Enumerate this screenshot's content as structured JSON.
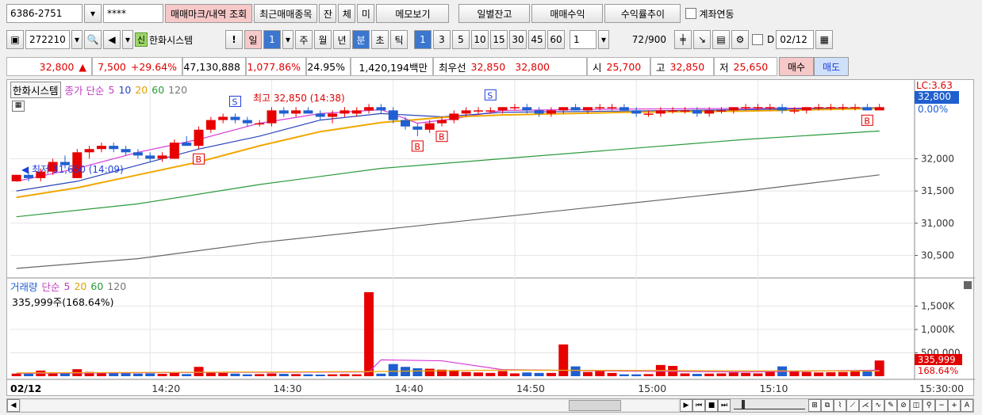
{
  "toolbar": {
    "account": "6386-2751",
    "password": "****",
    "btn_mark": "매매마크/내역 조회",
    "btn_recent": "최근매매종목",
    "btn_jan": "잔",
    "btn_che": "체",
    "btn_mi": "미",
    "btn_memo": "메모보기",
    "btn_daily": "일별잔고",
    "btn_profit": "매매수익",
    "btn_rate": "수익률추이",
    "chk_link": "계좌연동"
  },
  "chartbar": {
    "code": "272210",
    "badge": "신",
    "name": "한화시스템",
    "excl": "!",
    "day_label": "일",
    "day_value": "1",
    "periods": [
      "주",
      "월",
      "년"
    ],
    "min_label": "분",
    "sec_label": "초",
    "tick_label": "틱",
    "intervals": [
      "1",
      "3",
      "5",
      "10",
      "15",
      "30",
      "45",
      "60"
    ],
    "count_value": "1",
    "count_range": "72",
    "count_max": "/900",
    "d_label": "D",
    "date": "02/12"
  },
  "quote": {
    "price": "32,800",
    "arrow": "▲",
    "change": "7,500",
    "change_pct": "+29.64%",
    "volume": "47,130,888",
    "vol_ratio": "1,077.86%",
    "turnover": "24.95%",
    "amount": "1,420,194백만",
    "best_label": "최우선",
    "best_ask": "32,850",
    "best_bid": "32,800",
    "open_label": "시",
    "open": "25,700",
    "high_label": "고",
    "high": "32,850",
    "low_label": "저",
    "low": "25,650",
    "buy": "매수",
    "sell": "매도"
  },
  "price_legend": {
    "name": "한화시스템",
    "type": "종가 단순",
    "ma": [
      "5",
      "10",
      "20",
      "60",
      "120"
    ]
  },
  "volume_legend": {
    "name": "거래량",
    "type": "단순",
    "ma": [
      "5",
      "20",
      "60",
      "120"
    ],
    "value": "335,999주(168.64%)"
  },
  "annotations": {
    "high": "최고 32,850 (14:38)",
    "low": "최저 31,650 (14:09)",
    "lc": "LC:3.63",
    "last_price": "32,800",
    "last_pct": "0.00%",
    "last_volume": "335,999",
    "last_volume_pct": "168.64%"
  },
  "colors": {
    "up": "#e60000",
    "down": "#1f5fd0",
    "ma5": "#d63bd6",
    "ma10": "#2b45b8",
    "ma20": "#f0a800",
    "ma60": "#2a9a3a",
    "ma120": "#666666"
  },
  "chart_data": {
    "type": "candlestick",
    "price_axis": {
      "ticks": [
        32000,
        31500,
        31000,
        30500
      ],
      "tick_labels": [
        "32,000",
        "31,500",
        "31,000",
        "30,500"
      ],
      "range": [
        30200,
        33000
      ]
    },
    "volume_axis": {
      "ticks": [
        1500,
        1000,
        500
      ],
      "tick_labels": [
        "1,500K",
        "1,000K",
        "500,000"
      ],
      "range": [
        0,
        1900
      ]
    },
    "time_labels": [
      "02/12",
      "14:20",
      "14:30",
      "14:40",
      "14:50",
      "15:00",
      "15:10",
      "15:30:00"
    ],
    "candles": [
      {
        "t": "14:09",
        "o": 31650,
        "h": 31750,
        "l": 31650,
        "c": 31750
      },
      {
        "t": "14:10",
        "o": 31750,
        "h": 31800,
        "l": 31650,
        "c": 31700
      },
      {
        "t": "14:11",
        "o": 31700,
        "h": 31850,
        "l": 31650,
        "c": 31800
      },
      {
        "t": "14:12",
        "o": 31800,
        "h": 32000,
        "l": 31750,
        "c": 31950
      },
      {
        "t": "14:13",
        "o": 31950,
        "h": 32050,
        "l": 31850,
        "c": 31900
      },
      {
        "t": "14:14",
        "o": 31700,
        "h": 32150,
        "l": 31700,
        "c": 32100
      },
      {
        "t": "14:15",
        "o": 32100,
        "h": 32200,
        "l": 32000,
        "c": 32150
      },
      {
        "t": "14:16",
        "o": 32150,
        "h": 32250,
        "l": 32100,
        "c": 32200
      },
      {
        "t": "14:17",
        "o": 32200,
        "h": 32250,
        "l": 32100,
        "c": 32150
      },
      {
        "t": "14:18",
        "o": 32150,
        "h": 32200,
        "l": 32050,
        "c": 32100
      },
      {
        "t": "14:19",
        "o": 32100,
        "h": 32150,
        "l": 32000,
        "c": 32050
      },
      {
        "t": "14:20",
        "o": 32050,
        "h": 32100,
        "l": 31950,
        "c": 32000
      },
      {
        "t": "14:21",
        "o": 32000,
        "h": 32100,
        "l": 31950,
        "c": 32050
      },
      {
        "t": "14:22",
        "o": 32000,
        "h": 32300,
        "l": 32000,
        "c": 32250
      },
      {
        "t": "14:23",
        "o": 32250,
        "h": 32350,
        "l": 32200,
        "c": 32200
      },
      {
        "t": "14:24",
        "o": 32200,
        "h": 32500,
        "l": 32150,
        "c": 32450
      },
      {
        "t": "14:25",
        "o": 32450,
        "h": 32650,
        "l": 32400,
        "c": 32600
      },
      {
        "t": "14:26",
        "o": 32600,
        "h": 32700,
        "l": 32550,
        "c": 32650
      },
      {
        "t": "14:27",
        "o": 32650,
        "h": 32700,
        "l": 32550,
        "c": 32600
      },
      {
        "t": "14:28",
        "o": 32600,
        "h": 32650,
        "l": 32500,
        "c": 32550
      },
      {
        "t": "14:29",
        "o": 32550,
        "h": 32600,
        "l": 32500,
        "c": 32550
      },
      {
        "t": "14:30",
        "o": 32550,
        "h": 32800,
        "l": 32500,
        "c": 32750
      },
      {
        "t": "14:31",
        "o": 32750,
        "h": 32800,
        "l": 32650,
        "c": 32700
      },
      {
        "t": "14:32",
        "o": 32700,
        "h": 32800,
        "l": 32650,
        "c": 32750
      },
      {
        "t": "14:33",
        "o": 32750,
        "h": 32800,
        "l": 32700,
        "c": 32700
      },
      {
        "t": "14:34",
        "o": 32700,
        "h": 32750,
        "l": 32600,
        "c": 32650
      },
      {
        "t": "14:35",
        "o": 32650,
        "h": 32750,
        "l": 32550,
        "c": 32700
      },
      {
        "t": "14:36",
        "o": 32700,
        "h": 32800,
        "l": 32650,
        "c": 32750
      },
      {
        "t": "14:37",
        "o": 32700,
        "h": 32800,
        "l": 32650,
        "c": 32750
      },
      {
        "t": "14:38",
        "o": 32750,
        "h": 32850,
        "l": 32700,
        "c": 32800
      },
      {
        "t": "14:39",
        "o": 32800,
        "h": 32850,
        "l": 32700,
        "c": 32750
      },
      {
        "t": "14:40",
        "o": 32750,
        "h": 32800,
        "l": 32550,
        "c": 32600
      },
      {
        "t": "14:41",
        "o": 32600,
        "h": 32650,
        "l": 32450,
        "c": 32500
      },
      {
        "t": "14:42",
        "o": 32500,
        "h": 32550,
        "l": 32350,
        "c": 32450
      },
      {
        "t": "14:43",
        "o": 32450,
        "h": 32600,
        "l": 32400,
        "c": 32550
      },
      {
        "t": "14:44",
        "o": 32550,
        "h": 32650,
        "l": 32500,
        "c": 32600
      },
      {
        "t": "14:45",
        "o": 32600,
        "h": 32750,
        "l": 32550,
        "c": 32700
      },
      {
        "t": "14:46",
        "o": 32700,
        "h": 32800,
        "l": 32650,
        "c": 32750
      },
      {
        "t": "14:47",
        "o": 32750,
        "h": 32800,
        "l": 32700,
        "c": 32750
      },
      {
        "t": "14:48",
        "o": 32750,
        "h": 32800,
        "l": 32700,
        "c": 32750
      },
      {
        "t": "14:49",
        "o": 32750,
        "h": 32800,
        "l": 32700,
        "c": 32800
      },
      {
        "t": "14:50",
        "o": 32800,
        "h": 32850,
        "l": 32750,
        "c": 32800
      },
      {
        "t": "14:51",
        "o": 32800,
        "h": 32850,
        "l": 32700,
        "c": 32750
      },
      {
        "t": "14:52",
        "o": 32750,
        "h": 32800,
        "l": 32650,
        "c": 32700
      },
      {
        "t": "14:53",
        "o": 32700,
        "h": 32800,
        "l": 32650,
        "c": 32750
      },
      {
        "t": "14:54",
        "o": 32750,
        "h": 32800,
        "l": 32700,
        "c": 32800
      },
      {
        "t": "14:55",
        "o": 32800,
        "h": 32850,
        "l": 32750,
        "c": 32750
      },
      {
        "t": "14:56",
        "o": 32750,
        "h": 32800,
        "l": 32700,
        "c": 32800
      },
      {
        "t": "14:57",
        "o": 32800,
        "h": 32850,
        "l": 32750,
        "c": 32800
      },
      {
        "t": "14:58",
        "o": 32800,
        "h": 32850,
        "l": 32750,
        "c": 32800
      },
      {
        "t": "14:59",
        "o": 32800,
        "h": 32850,
        "l": 32750,
        "c": 32750
      },
      {
        "t": "15:00",
        "o": 32750,
        "h": 32800,
        "l": 32650,
        "c": 32700
      },
      {
        "t": "15:01",
        "o": 32700,
        "h": 32750,
        "l": 32650,
        "c": 32700
      },
      {
        "t": "15:02",
        "o": 32700,
        "h": 32800,
        "l": 32650,
        "c": 32750
      },
      {
        "t": "15:03",
        "o": 32750,
        "h": 32800,
        "l": 32700,
        "c": 32750
      },
      {
        "t": "15:04",
        "o": 32750,
        "h": 32800,
        "l": 32700,
        "c": 32750
      },
      {
        "t": "15:05",
        "o": 32750,
        "h": 32800,
        "l": 32650,
        "c": 32700
      },
      {
        "t": "15:06",
        "o": 32700,
        "h": 32800,
        "l": 32650,
        "c": 32750
      },
      {
        "t": "15:07",
        "o": 32750,
        "h": 32800,
        "l": 32700,
        "c": 32750
      },
      {
        "t": "15:08",
        "o": 32750,
        "h": 32800,
        "l": 32700,
        "c": 32800
      },
      {
        "t": "15:09",
        "o": 32800,
        "h": 32850,
        "l": 32750,
        "c": 32800
      },
      {
        "t": "15:10",
        "o": 32800,
        "h": 32850,
        "l": 32750,
        "c": 32800
      },
      {
        "t": "15:11",
        "o": 32800,
        "h": 32850,
        "l": 32750,
        "c": 32800
      },
      {
        "t": "15:12",
        "o": 32800,
        "h": 32850,
        "l": 32700,
        "c": 32750
      },
      {
        "t": "15:13",
        "o": 32750,
        "h": 32800,
        "l": 32700,
        "c": 32750
      },
      {
        "t": "15:14",
        "o": 32750,
        "h": 32800,
        "l": 32700,
        "c": 32800
      },
      {
        "t": "15:15",
        "o": 32800,
        "h": 32850,
        "l": 32750,
        "c": 32800
      },
      {
        "t": "15:16",
        "o": 32800,
        "h": 32850,
        "l": 32750,
        "c": 32800
      },
      {
        "t": "15:17",
        "o": 32800,
        "h": 32850,
        "l": 32750,
        "c": 32800
      },
      {
        "t": "15:18",
        "o": 32800,
        "h": 32850,
        "l": 32750,
        "c": 32800
      },
      {
        "t": "15:19",
        "o": 32800,
        "h": 32850,
        "l": 32750,
        "c": 32750
      },
      {
        "t": "15:20",
        "o": 32750,
        "h": 32850,
        "l": 32750,
        "c": 32800
      }
    ],
    "volumes_k": [
      55,
      60,
      120,
      80,
      70,
      150,
      90,
      60,
      70,
      65,
      55,
      60,
      50,
      75,
      45,
      200,
      85,
      70,
      55,
      40,
      45,
      60,
      50,
      45,
      40,
      35,
      40,
      45,
      40,
      1800,
      55,
      260,
      200,
      170,
      160,
      140,
      130,
      90,
      80,
      70,
      110,
      60,
      80,
      70,
      70,
      680,
      210,
      90,
      110,
      70,
      40,
      40,
      45,
      240,
      220,
      60,
      50,
      55,
      60,
      80,
      70,
      60,
      100,
      210,
      110,
      90,
      80,
      85,
      90,
      100,
      110,
      336
    ],
    "ma": {
      "ma5": [
        [
          0,
          31650
        ],
        [
          5,
          31850
        ],
        [
          10,
          32100
        ],
        [
          15,
          32300
        ],
        [
          20,
          32550
        ],
        [
          25,
          32700
        ],
        [
          30,
          32760
        ],
        [
          33,
          32550
        ],
        [
          36,
          32620
        ],
        [
          40,
          32750
        ],
        [
          50,
          32770
        ],
        [
          60,
          32780
        ],
        [
          71,
          32790
        ]
      ],
      "ma10": [
        [
          0,
          31500
        ],
        [
          5,
          31650
        ],
        [
          10,
          31900
        ],
        [
          15,
          32150
        ],
        [
          20,
          32350
        ],
        [
          25,
          32600
        ],
        [
          30,
          32700
        ],
        [
          35,
          32650
        ],
        [
          40,
          32720
        ],
        [
          50,
          32740
        ],
        [
          60,
          32760
        ],
        [
          71,
          32790
        ]
      ],
      "ma20": [
        [
          0,
          31400
        ],
        [
          5,
          31550
        ],
        [
          10,
          31750
        ],
        [
          15,
          31950
        ],
        [
          20,
          32200
        ],
        [
          25,
          32420
        ],
        [
          30,
          32560
        ],
        [
          35,
          32640
        ],
        [
          40,
          32680
        ],
        [
          50,
          32720
        ],
        [
          60,
          32740
        ],
        [
          71,
          32780
        ]
      ],
      "ma60": [
        [
          0,
          31100
        ],
        [
          10,
          31300
        ],
        [
          20,
          31600
        ],
        [
          30,
          31850
        ],
        [
          40,
          32000
        ],
        [
          50,
          32150
        ],
        [
          60,
          32300
        ],
        [
          71,
          32430
        ]
      ],
      "ma120": [
        [
          0,
          30300
        ],
        [
          10,
          30450
        ],
        [
          20,
          30700
        ],
        [
          30,
          30900
        ],
        [
          40,
          31100
        ],
        [
          50,
          31300
        ],
        [
          60,
          31500
        ],
        [
          71,
          31750
        ]
      ]
    },
    "signals": [
      {
        "i": 15,
        "type": "B"
      },
      {
        "i": 33,
        "type": "B"
      },
      {
        "i": 35,
        "type": "B"
      },
      {
        "i": 18,
        "type": "S"
      },
      {
        "i": 39,
        "type": "S"
      },
      {
        "i": 70,
        "type": "B"
      }
    ]
  }
}
